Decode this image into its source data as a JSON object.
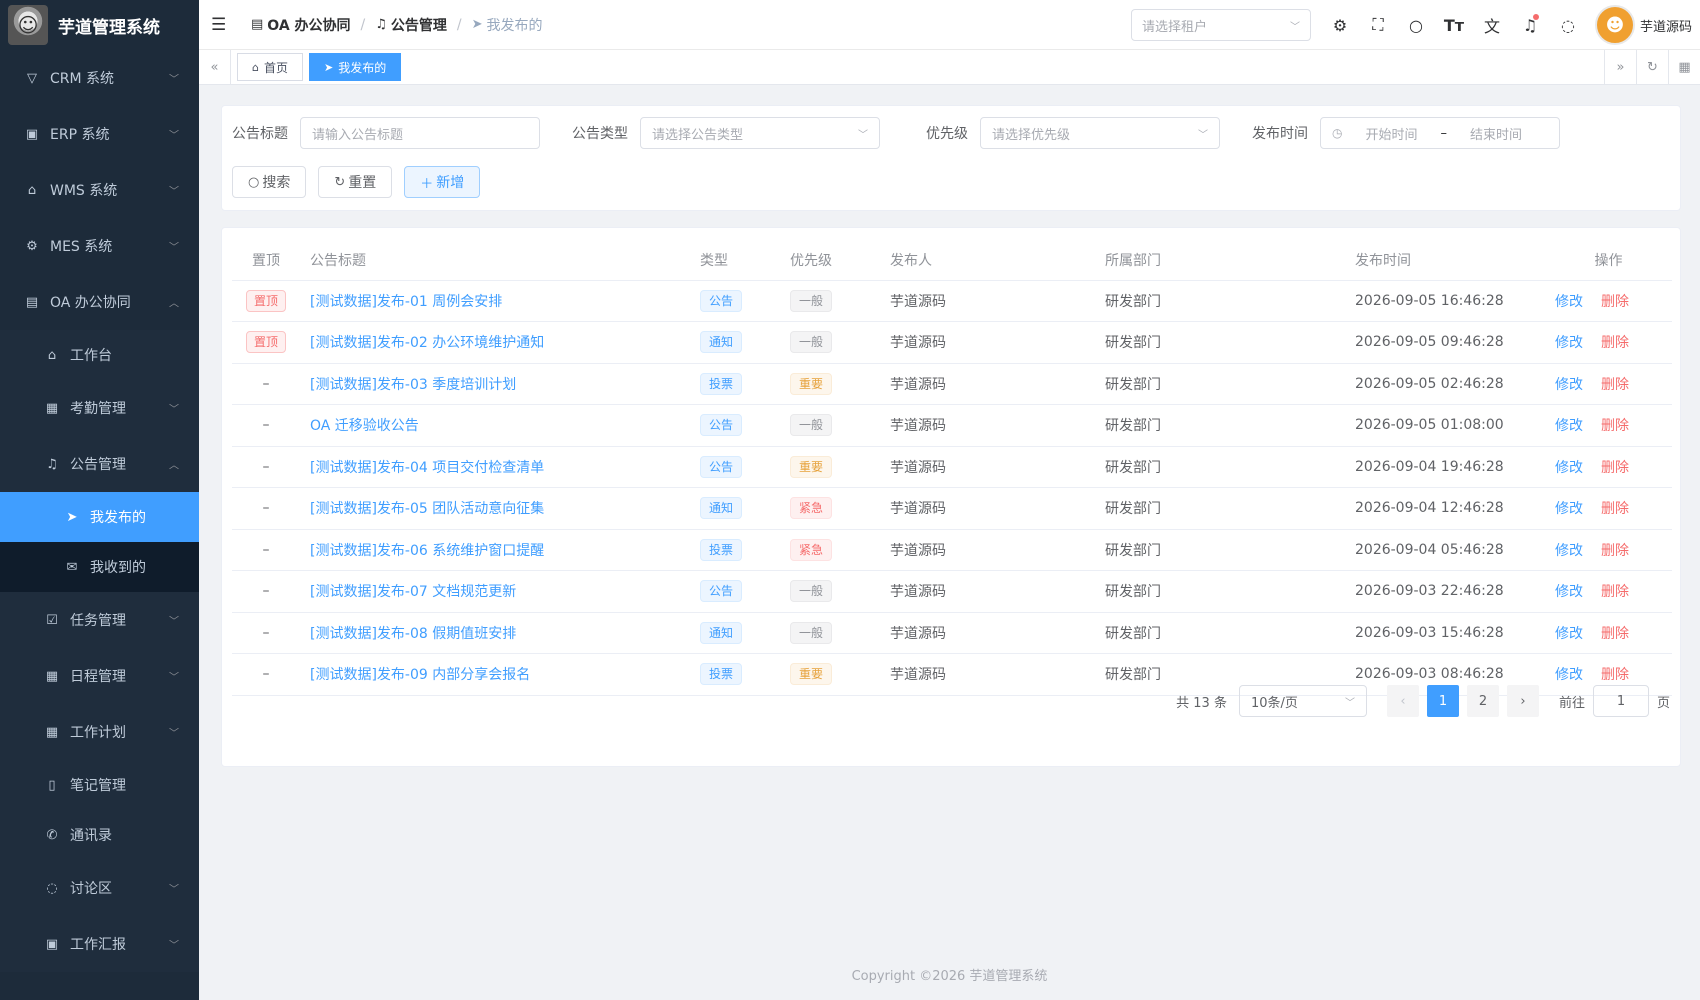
{
  "app": {
    "title": "芋道管理系统"
  },
  "sidebar": {
    "items": [
      {
        "label": "CRM 系统",
        "icon": "crm-icon"
      },
      {
        "label": "ERP 系统",
        "icon": "erp-icon"
      },
      {
        "label": "WMS 系统",
        "icon": "wms-icon"
      },
      {
        "label": "MES 系统",
        "icon": "mes-icon"
      },
      {
        "label": "OA 办公协同",
        "icon": "building-icon"
      }
    ],
    "oa_children": [
      {
        "label": "工作台"
      },
      {
        "label": "考勤管理"
      },
      {
        "label": "公告管理"
      },
      {
        "label": "任务管理"
      },
      {
        "label": "日程管理"
      },
      {
        "label": "工作计划"
      },
      {
        "label": "笔记管理"
      },
      {
        "label": "通讯录"
      },
      {
        "label": "讨论区"
      },
      {
        "label": "工作汇报"
      }
    ],
    "notice_children": [
      {
        "label": "我发布的"
      },
      {
        "label": "我收到的"
      }
    ]
  },
  "header": {
    "breadcrumb": [
      "OA 办公协同",
      "公告管理",
      "我发布的"
    ],
    "tenant_placeholder": "请选择租户",
    "username": "芋道源码"
  },
  "tags": {
    "home": "首页",
    "active": "我发布的"
  },
  "search": {
    "title_label": "公告标题",
    "title_placeholder": "请输入公告标题",
    "type_label": "公告类型",
    "type_placeholder": "请选择公告类型",
    "priority_label": "优先级",
    "priority_placeholder": "请选择优先级",
    "time_label": "发布时间",
    "start_placeholder": "开始时间",
    "range_sep": "–",
    "end_placeholder": "结束时间",
    "search_btn": "搜索",
    "reset_btn": "重置",
    "add_btn": "新增"
  },
  "table": {
    "headers": [
      "置顶",
      "公告标题",
      "类型",
      "优先级",
      "发布人",
      "所属部门",
      "发布时间",
      "操作"
    ],
    "edit_label": "修改",
    "delete_label": "删除",
    "rows": [
      {
        "pin": "置顶",
        "title": "[测试数据]发布-01 周例会安排",
        "type": "公告",
        "type_color": "blue",
        "priority": "一般",
        "priority_color": "gray",
        "publisher": "芋道源码",
        "dept": "研发部门",
        "time": "2026-09-05 16:46:28"
      },
      {
        "pin": "置顶",
        "title": "[测试数据]发布-02 办公环境维护通知",
        "type": "通知",
        "type_color": "blue",
        "priority": "一般",
        "priority_color": "gray",
        "publisher": "芋道源码",
        "dept": "研发部门",
        "time": "2026-09-05 09:46:28"
      },
      {
        "pin": "–",
        "title": "[测试数据]发布-03 季度培训计划",
        "type": "投票",
        "type_color": "blue",
        "priority": "重要",
        "priority_color": "orange",
        "publisher": "芋道源码",
        "dept": "研发部门",
        "time": "2026-09-05 02:46:28"
      },
      {
        "pin": "–",
        "title": "OA 迁移验收公告",
        "type": "公告",
        "type_color": "blue",
        "priority": "一般",
        "priority_color": "gray",
        "publisher": "芋道源码",
        "dept": "研发部门",
        "time": "2026-09-05 01:08:00"
      },
      {
        "pin": "–",
        "title": "[测试数据]发布-04 项目交付检查清单",
        "type": "公告",
        "type_color": "blue",
        "priority": "重要",
        "priority_color": "orange",
        "publisher": "芋道源码",
        "dept": "研发部门",
        "time": "2026-09-04 19:46:28"
      },
      {
        "pin": "–",
        "title": "[测试数据]发布-05 团队活动意向征集",
        "type": "通知",
        "type_color": "blue",
        "priority": "紧急",
        "priority_color": "red",
        "publisher": "芋道源码",
        "dept": "研发部门",
        "time": "2026-09-04 12:46:28"
      },
      {
        "pin": "–",
        "title": "[测试数据]发布-06 系统维护窗口提醒",
        "type": "投票",
        "type_color": "blue",
        "priority": "紧急",
        "priority_color": "red",
        "publisher": "芋道源码",
        "dept": "研发部门",
        "time": "2026-09-04 05:46:28"
      },
      {
        "pin": "–",
        "title": "[测试数据]发布-07 文档规范更新",
        "type": "公告",
        "type_color": "blue",
        "priority": "一般",
        "priority_color": "gray",
        "publisher": "芋道源码",
        "dept": "研发部门",
        "time": "2026-09-03 22:46:28"
      },
      {
        "pin": "–",
        "title": "[测试数据]发布-08 假期值班安排",
        "type": "通知",
        "type_color": "blue",
        "priority": "一般",
        "priority_color": "gray",
        "publisher": "芋道源码",
        "dept": "研发部门",
        "time": "2026-09-03 15:46:28"
      },
      {
        "pin": "–",
        "title": "[测试数据]发布-09 内部分享会报名",
        "type": "投票",
        "type_color": "blue",
        "priority": "重要",
        "priority_color": "orange",
        "publisher": "芋道源码",
        "dept": "研发部门",
        "time": "2026-09-03 08:46:28"
      }
    ]
  },
  "pagination": {
    "total": "共 13 条",
    "page_size": "10条/页",
    "pages": [
      "1",
      "2"
    ],
    "current": "1",
    "goto_label": "前往",
    "goto_value": "1",
    "page_suffix": "页"
  },
  "footer": {
    "copyright": "Copyright ©2026 芋道管理系统"
  },
  "colors": {
    "primary": "#409eff",
    "danger": "#f56c6c",
    "sidebar_bg": "#1d2b3a"
  }
}
